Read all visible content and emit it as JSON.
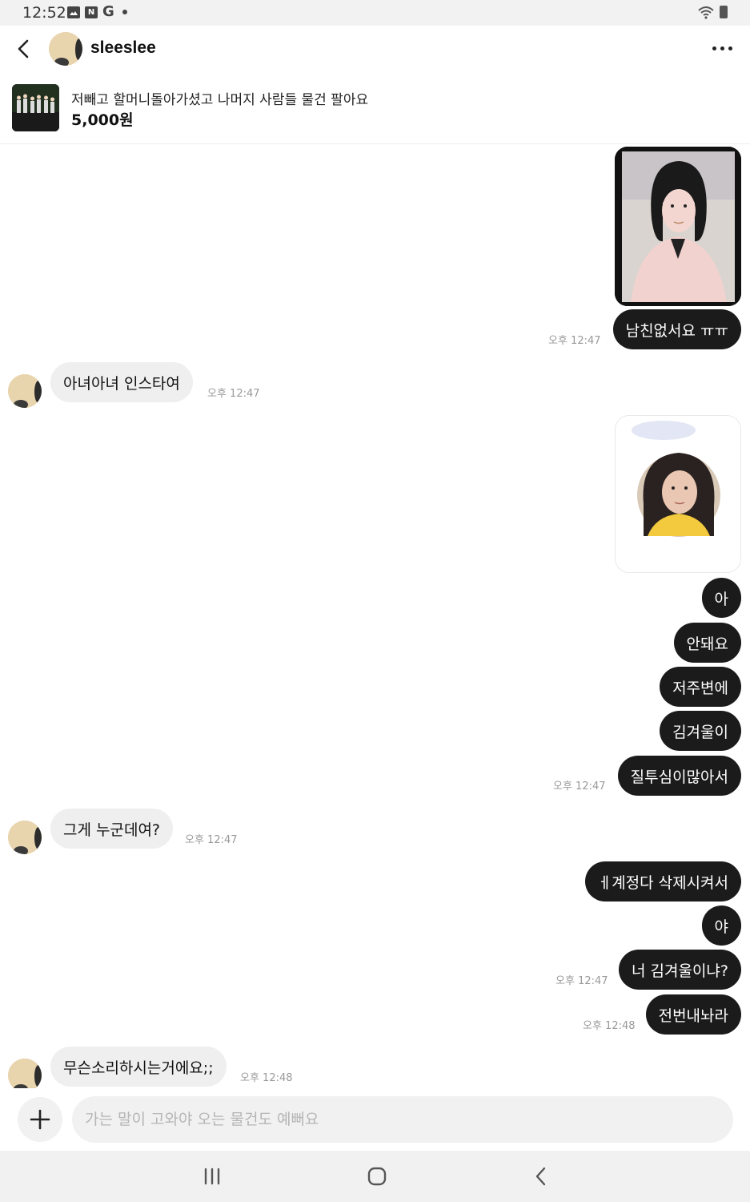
{
  "status_bar": {
    "time": "12:52",
    "left_icons": [
      "image-icon",
      "n-app-icon",
      "google-icon",
      "notification-dot-icon"
    ],
    "right_icons": [
      "wifi-icon",
      "battery-icon"
    ],
    "n_icon_glyph": "N",
    "g_icon_glyph": "G"
  },
  "header": {
    "username": "sleeslee",
    "icons": [
      "back-arrow-icon",
      "more-icon"
    ]
  },
  "product": {
    "title": "저빼고 할머니돌아가셨고 나머지  사람들 물건 팔아요",
    "price": "5,000원"
  },
  "messages": [
    {
      "side": "out",
      "type": "image"
    },
    {
      "side": "out",
      "text": "남친없서요 ㅠㅠ",
      "time": "오후 12:47"
    },
    {
      "side": "in",
      "text": "아녀아녀 인스타여",
      "time": "오후 12:47"
    },
    {
      "side": "out",
      "type": "image"
    },
    {
      "side": "out",
      "text": "아"
    },
    {
      "side": "out",
      "text": "안돼요"
    },
    {
      "side": "out",
      "text": "저주변에"
    },
    {
      "side": "out",
      "text": "김겨울이"
    },
    {
      "side": "out",
      "text": "질투심이많아서",
      "time": "오후 12:47"
    },
    {
      "side": "in",
      "text": "그게 누군데여?",
      "time": "오후 12:47"
    },
    {
      "side": "out",
      "text": "ㅔ계정다 삭제시켜서"
    },
    {
      "side": "out",
      "text": "야"
    },
    {
      "side": "out",
      "text": "너 김겨울이냐?",
      "time": "오후 12:47"
    },
    {
      "side": "out",
      "text": "전번내놔라",
      "time": "오후 12:48"
    },
    {
      "side": "in",
      "text": "무슨소리하시는거에요;;",
      "time": "오후 12:48"
    }
  ],
  "input": {
    "placeholder": "가는 말이 고와야 오는 물건도 예뻐요"
  },
  "colors": {
    "outgoing_bubble": "#1b1b1b",
    "incoming_bubble": "#efefef",
    "timestamp": "#999999"
  }
}
